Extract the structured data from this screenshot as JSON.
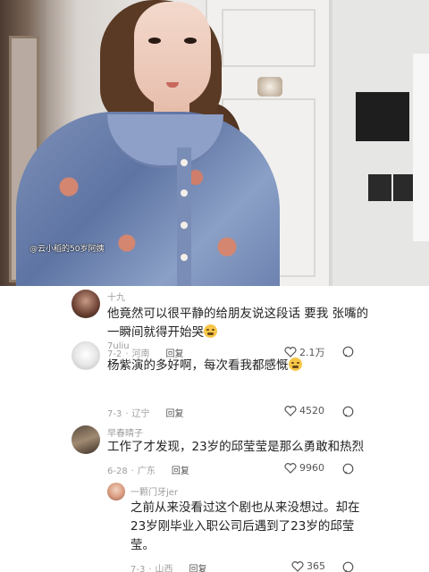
{
  "video": {
    "watermark": "@云小稻的50岁阿姨"
  },
  "comments": [
    {
      "user": "十九",
      "text": "他竟然可以很平静的给朋友说这段话 要我 张嘴的一瞬间就得开始哭",
      "emoji": "crying-emoji",
      "date": "7-2",
      "location": "河南",
      "reply_label": "回复",
      "likes": "2.1万"
    },
    {
      "user": "7uliu",
      "text": "杨紫演的多好啊，每次看我都感慨",
      "emoji": "crying-emoji",
      "date": "7-3",
      "location": "辽宁",
      "reply_label": "回复",
      "likes": "4520"
    },
    {
      "user": "早春晴子",
      "text": "工作了才发现，23岁的邱莹莹是那么勇敢和热烈",
      "date": "6-28",
      "location": "广东",
      "reply_label": "回复",
      "likes": "9960"
    },
    {
      "user": "一颗门牙jer",
      "text": "之前从来没看过这个剧也从来没想过。却在23岁刚毕业入职公司后遇到了23岁的邱莹莹。",
      "date": "7-3",
      "location": "山西",
      "reply_label": "回复",
      "likes": "365"
    }
  ],
  "colors": {
    "like_icon": "#555555",
    "meta_text": "#a0a0a0",
    "username": "#9a9a9a"
  }
}
